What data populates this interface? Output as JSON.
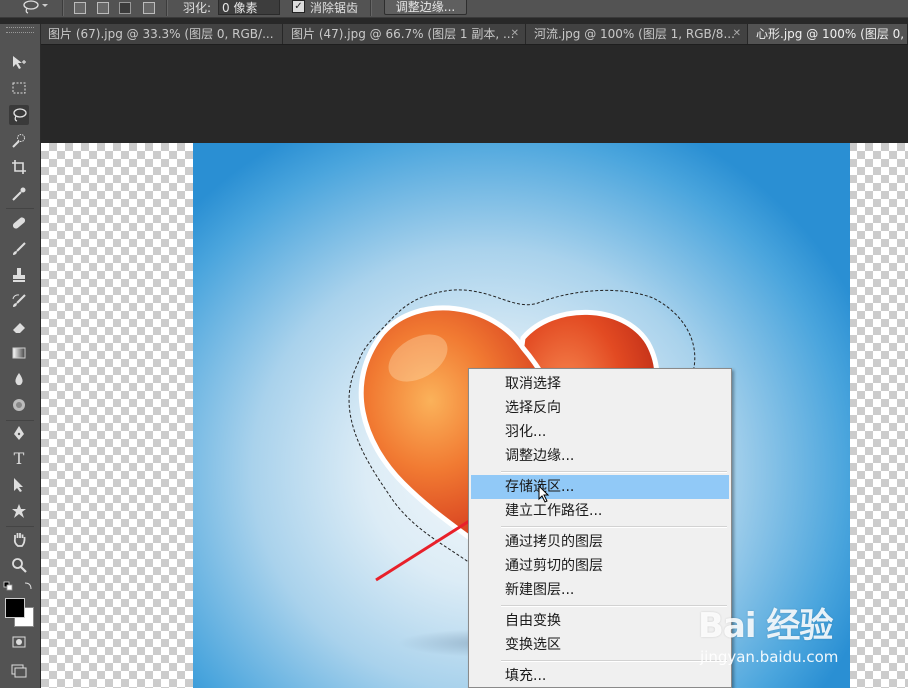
{
  "options_bar": {
    "feather_label": "羽化:",
    "feather_value": "0 像素",
    "antialias_label": "消除锯齿",
    "antialias_checked": true,
    "refine_edge_button": "调整边缘..."
  },
  "tabs": [
    {
      "label": "图片 (67).jpg @ 33.3% (图层 0, RGB/...",
      "active": false
    },
    {
      "label": "图片 (47).jpg @ 66.7% (图层 1 副本, ...",
      "active": false
    },
    {
      "label": "河流.jpg @ 100% (图层 1, RGB/8...",
      "active": false
    },
    {
      "label": "心形.jpg @ 100% (图层 0, ...",
      "active": true
    }
  ],
  "toolbar": {
    "icons": [
      "move-tool-icon",
      "rect-marquee-icon",
      "lasso-icon",
      "quick-select-icon",
      "crop-icon",
      "eyedropper-icon",
      "healing-brush-icon",
      "brush-icon",
      "clone-stamp-icon",
      "history-brush-icon",
      "eraser-icon",
      "gradient-icon",
      "blur-icon",
      "dodge-icon",
      "pen-icon",
      "type-icon",
      "path-select-icon",
      "shape-icon",
      "hand-icon",
      "zoom-icon",
      "color-swatches-icon",
      "quick-mask-icon",
      "screen-mode-icon"
    ],
    "foreground_color": "#000000",
    "background_color": "#ffffff",
    "type_tool_glyph": "T"
  },
  "context_menu": {
    "items": [
      {
        "label": "取消选择",
        "highlighted": false
      },
      {
        "label": "选择反向",
        "highlighted": false
      },
      {
        "label": "羽化...",
        "highlighted": false
      },
      {
        "label": "调整边缘...",
        "highlighted": false
      },
      {
        "label": "存储选区...",
        "highlighted": true
      },
      {
        "label": "建立工作路径...",
        "highlighted": false
      },
      {
        "label": "通过拷贝的图层",
        "highlighted": false
      },
      {
        "label": "通过剪切的图层",
        "highlighted": false
      },
      {
        "label": "新建图层...",
        "highlighted": false
      },
      {
        "label": "自由变换",
        "highlighted": false
      },
      {
        "label": "变换选区",
        "highlighted": false
      },
      {
        "label": "填充...",
        "highlighted": false
      }
    ]
  },
  "watermark": {
    "logo": "Bai 经验",
    "url": "jingyan.baidu.com"
  },
  "colors": {
    "highlight": "#91c9f7",
    "annotation_arrow": "#e8202a",
    "heart": "#e24a22"
  }
}
